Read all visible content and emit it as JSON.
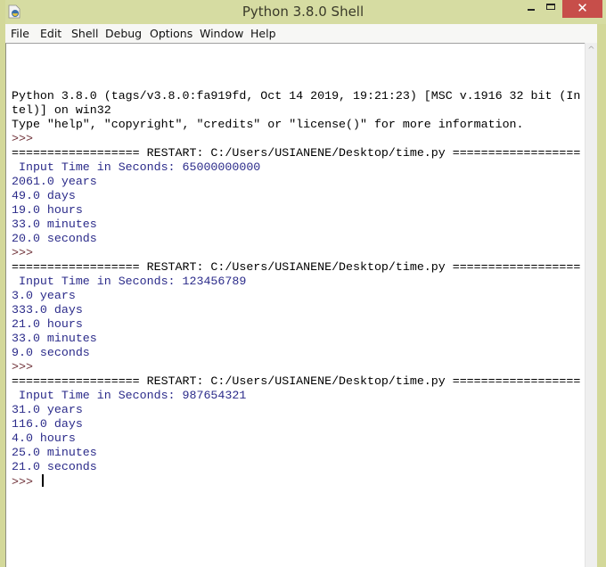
{
  "window": {
    "title": "Python 3.8.0 Shell",
    "app_icon": "python-idle-icon",
    "controls": {
      "minimize_icon": "minimize-icon",
      "maximize_icon": "maximize-icon",
      "close_glyph": "✕"
    }
  },
  "menu": {
    "items": [
      {
        "label": "File"
      },
      {
        "label": "Edit"
      },
      {
        "label": "Shell"
      },
      {
        "label": "Debug"
      },
      {
        "label": "Options"
      },
      {
        "label": "Window"
      },
      {
        "label": "Help"
      }
    ]
  },
  "shell": {
    "lines": [
      {
        "text": "Python 3.8.0 (tags/v3.8.0:fa919fd, Oct 14 2019, 19:21:23) [MSC v.1916 32 bit (In",
        "kind": "out"
      },
      {
        "text": "tel)] on win32",
        "kind": "out"
      },
      {
        "text": "Type \"help\", \"copyright\", \"credits\" or \"license()\" for more information.",
        "kind": "out"
      },
      {
        "text": ">>> ",
        "kind": "prompt"
      },
      {
        "text": "================== RESTART: C:/Users/USIANENE/Desktop/time.py ==================",
        "kind": "restart"
      },
      {
        "text": " Input Time in Seconds: 65000000000",
        "kind": "stdout"
      },
      {
        "text": "2061.0 years",
        "kind": "stdout"
      },
      {
        "text": "49.0 days",
        "kind": "stdout"
      },
      {
        "text": "19.0 hours",
        "kind": "stdout"
      },
      {
        "text": "33.0 minutes",
        "kind": "stdout"
      },
      {
        "text": "20.0 seconds",
        "kind": "stdout"
      },
      {
        "text": ">>> ",
        "kind": "prompt"
      },
      {
        "text": "================== RESTART: C:/Users/USIANENE/Desktop/time.py ==================",
        "kind": "restart"
      },
      {
        "text": " Input Time in Seconds: 123456789",
        "kind": "stdout"
      },
      {
        "text": "3.0 years",
        "kind": "stdout"
      },
      {
        "text": "333.0 days",
        "kind": "stdout"
      },
      {
        "text": "21.0 hours",
        "kind": "stdout"
      },
      {
        "text": "33.0 minutes",
        "kind": "stdout"
      },
      {
        "text": "9.0 seconds",
        "kind": "stdout"
      },
      {
        "text": ">>> ",
        "kind": "prompt"
      },
      {
        "text": "================== RESTART: C:/Users/USIANENE/Desktop/time.py ==================",
        "kind": "restart"
      },
      {
        "text": " Input Time in Seconds: 987654321",
        "kind": "stdout"
      },
      {
        "text": "31.0 years",
        "kind": "stdout"
      },
      {
        "text": "116.0 days",
        "kind": "stdout"
      },
      {
        "text": "4.0 hours",
        "kind": "stdout"
      },
      {
        "text": "25.0 minutes",
        "kind": "stdout"
      },
      {
        "text": "21.0 seconds",
        "kind": "stdout"
      }
    ],
    "current_prompt": ">>> ",
    "input_value": ""
  },
  "scrollbar": {
    "up_arrow_glyph": "^"
  },
  "colors": {
    "title_bar": "#d6dca2",
    "close_button": "#c74e4a",
    "stdout_text": "#2b2b8a",
    "prompt_text": "#6d2f36",
    "output_text": "#000000"
  }
}
